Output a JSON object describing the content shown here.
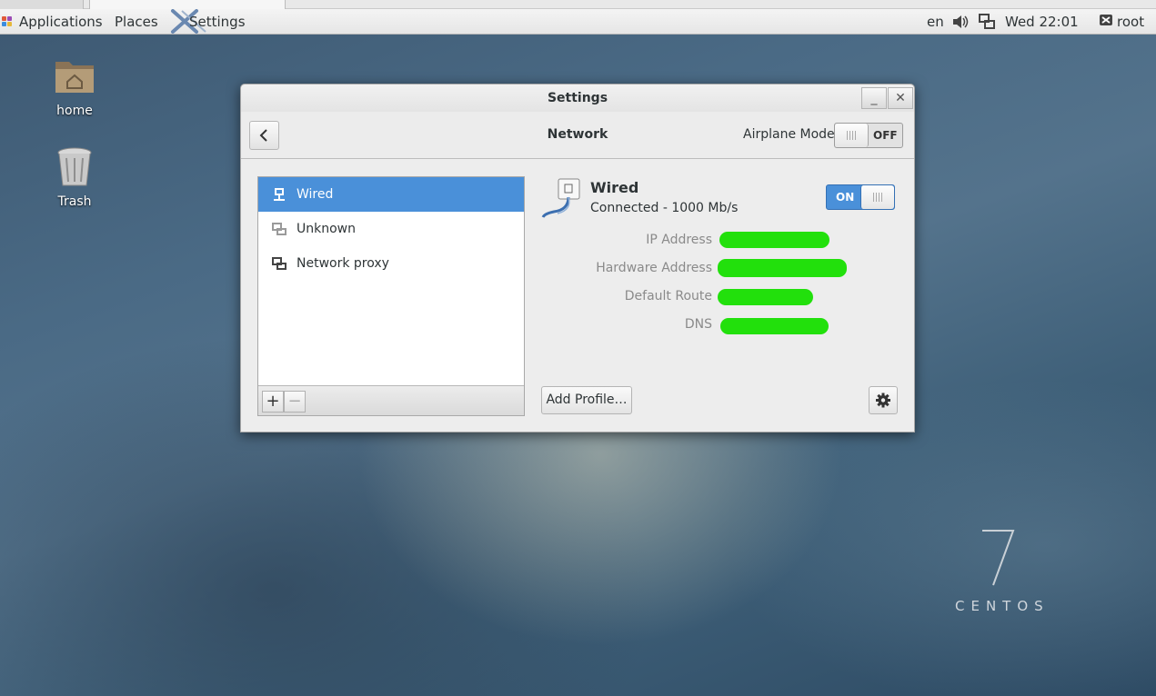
{
  "panel": {
    "applications": "Applications",
    "places": "Places",
    "active_app": "Settings",
    "language": "en",
    "clock": "Wed 22:01",
    "user": "root"
  },
  "desktop": {
    "home_label": "home",
    "trash_label": "Trash"
  },
  "window": {
    "title": "Settings",
    "minimize_glyph": "_",
    "close_glyph": "✕",
    "header_title": "Network",
    "airplane_label": "Airplane Mode",
    "airplane_state": "OFF",
    "list": [
      {
        "label": "Wired",
        "icon": "wired-network-icon",
        "selected": true
      },
      {
        "label": "Unknown",
        "icon": "network-unknown-icon",
        "selected": false
      },
      {
        "label": "Network proxy",
        "icon": "network-proxy-icon",
        "selected": false
      }
    ],
    "add_glyph": "+",
    "remove_glyph": "−",
    "detail": {
      "title": "Wired",
      "status": "Connected - 1000 Mb/s",
      "switch_state": "ON",
      "labels": {
        "ip": "IP Address",
        "hw": "Hardware Address",
        "route": "Default Route",
        "dns": "DNS"
      }
    },
    "add_profile": "Add Profile…"
  },
  "branding": {
    "version": "7",
    "name": "CENTOS"
  },
  "colors": {
    "selection": "#4a90d9",
    "redaction": "#22e00c",
    "switch_on": "#4a90d9"
  }
}
